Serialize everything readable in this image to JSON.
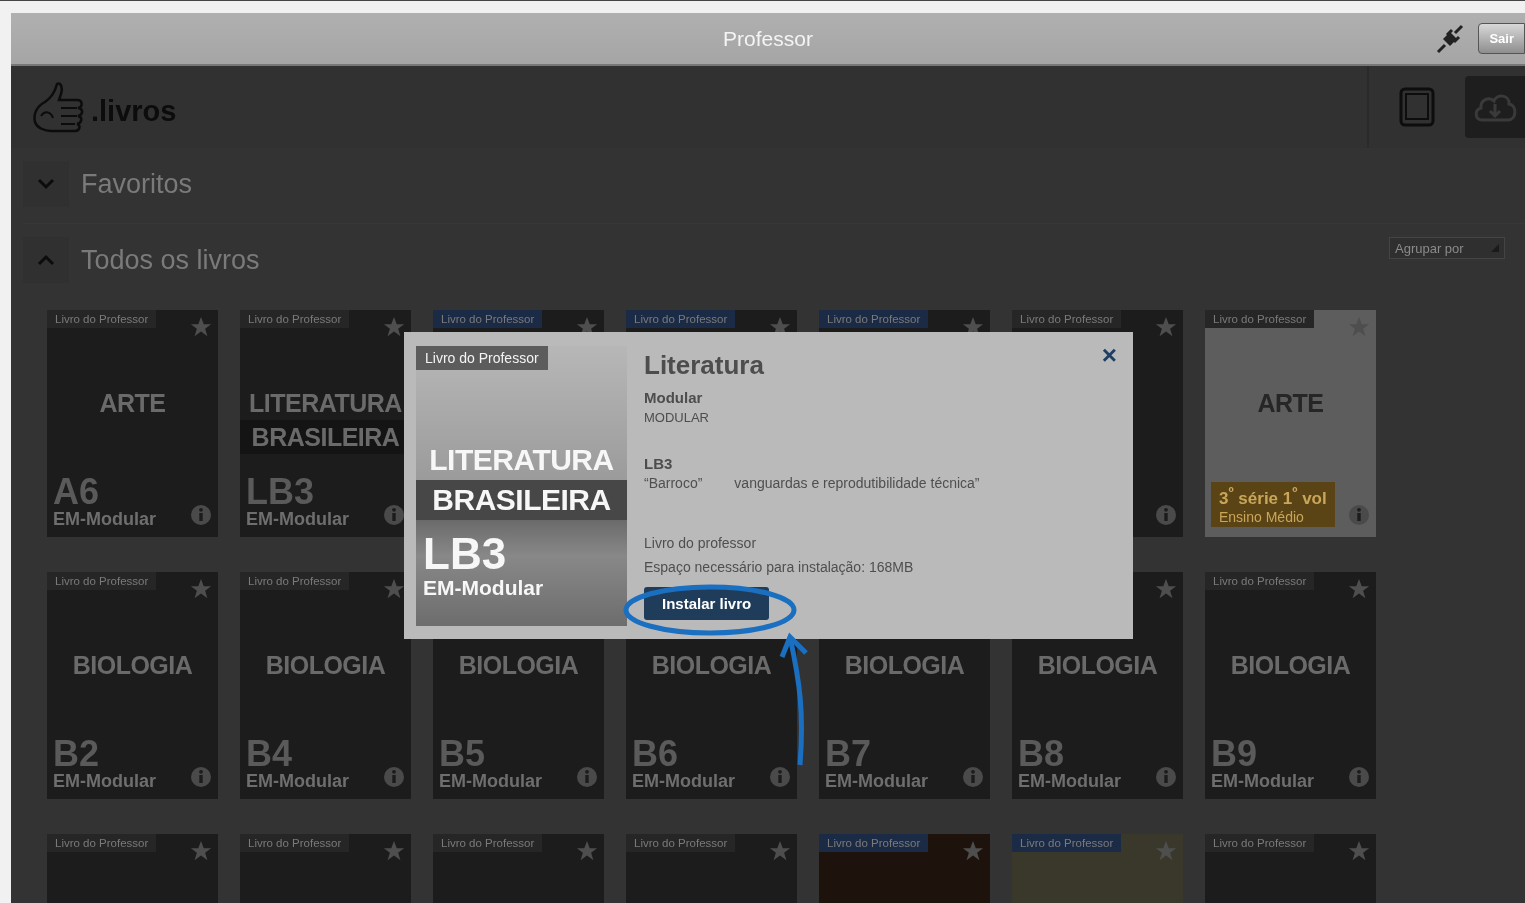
{
  "title_bar": {
    "title": "Professor",
    "logout_button": "Sair"
  },
  "header": {
    "logo_text": ".livros",
    "views": [
      {
        "kind": "tablet",
        "selected": false
      },
      {
        "kind": "cloud",
        "selected": true
      }
    ]
  },
  "sections": [
    {
      "title": "Favoritos",
      "expanded": false
    },
    {
      "title": "Todos os livros",
      "expanded": true,
      "group_select": "Agrupar por"
    }
  ],
  "books": [
    {
      "kind": "dark",
      "tag": {
        "label": "Livro do Professor",
        "color": "#262626"
      },
      "has_star": true,
      "has_info": true,
      "title_lines": [
        "ARTE"
      ],
      "code": "A6",
      "series": "EM-Modular"
    },
    {
      "kind": "banded",
      "tag": {
        "label": "Livro do Professor",
        "color": "#262626"
      },
      "has_star": true,
      "has_info": true,
      "title_lines": [
        "LITERATURA",
        "BRASILEIRA"
      ],
      "code": "LB3",
      "series": "EM-Modular"
    },
    {
      "kind": "dark",
      "tag": {
        "label": "Livro do Professor",
        "color": "#1b2b46"
      },
      "has_star": true,
      "has_info": false
    },
    {
      "kind": "dark",
      "tag": {
        "label": "Livro do Professor",
        "color": "#1b2b46"
      },
      "has_star": true,
      "has_info": false
    },
    {
      "kind": "dark",
      "tag": {
        "label": "Livro do Professor",
        "color": "#1b2b46"
      },
      "has_star": true,
      "has_info": false
    },
    {
      "kind": "dark",
      "tag": {
        "label": "Livro do Professor",
        "color": "#262626"
      },
      "has_star": true,
      "has_info": true
    },
    {
      "kind": "light",
      "tag": {
        "label": "Livro do Professor",
        "color": "#262626"
      },
      "has_star": true,
      "has_info": true,
      "title_lines": [
        "ARTE"
      ],
      "badge": [
        "3$^{º}$ série 1$^{º}$ vol",
        "Ensino Médio"
      ]
    },
    {
      "kind": "dark",
      "tag": {
        "label": "Livro do Professor",
        "color": "#262626"
      },
      "has_star": true,
      "has_info": true,
      "title_lines": [
        "BIOLOGIA"
      ],
      "code": "B2",
      "series": "EM-Modular"
    },
    {
      "kind": "dark",
      "tag": {
        "label": "Livro do Professor",
        "color": "#262626"
      },
      "has_star": true,
      "has_info": true,
      "title_lines": [
        "BIOLOGIA"
      ],
      "code": "B4",
      "series": "EM-Modular"
    },
    {
      "kind": "dark",
      "has_star": false,
      "has_info": true,
      "title_lines": [
        "BIOLOGIA"
      ],
      "code": "B5",
      "series": "EM-Modular"
    },
    {
      "kind": "dark",
      "has_star": false,
      "has_info": true,
      "title_lines": [
        "BIOLOGIA"
      ],
      "code": "B6",
      "series": "EM-Modular"
    },
    {
      "kind": "dark",
      "has_star": false,
      "has_info": true,
      "title_lines": [
        "BIOLOGIA"
      ],
      "code": "B7",
      "series": "EM-Modular"
    },
    {
      "kind": "dark",
      "has_star": true,
      "has_info": true,
      "title_lines": [
        "BIOLOGIA"
      ],
      "code": "B8",
      "series": "EM-Modular"
    },
    {
      "kind": "dark",
      "tag": {
        "label": "Livro do Professor",
        "color": "#262626"
      },
      "has_star": true,
      "has_info": true,
      "title_lines": [
        "BIOLOGIA"
      ],
      "code": "B9",
      "series": "EM-Modular"
    },
    {
      "kind": "dark",
      "tag": {
        "label": "Livro do Professor",
        "color": "#262626"
      },
      "has_star": true,
      "has_info": false
    },
    {
      "kind": "dark",
      "tag": {
        "label": "Livro do Professor",
        "color": "#262626"
      },
      "has_star": true,
      "has_info": false
    },
    {
      "kind": "dark",
      "tag": {
        "label": "Livro do Professor",
        "color": "#262626"
      },
      "has_star": true,
      "has_info": false
    },
    {
      "kind": "dark",
      "tag": {
        "label": "Livro do Professor",
        "color": "#262626"
      },
      "has_star": true,
      "has_info": false
    },
    {
      "kind": "brown",
      "tag": {
        "label": "Livro do Professor",
        "color": "#1b2b46"
      },
      "has_star": true,
      "has_info": false
    },
    {
      "kind": "olive",
      "tag": {
        "label": "Livro do Professor",
        "color": "#1b2b46"
      },
      "has_star": true,
      "has_info": false
    },
    {
      "kind": "dark",
      "tag": {
        "label": "Livro do Professor",
        "color": "#262626"
      },
      "has_star": true,
      "has_info": false
    }
  ],
  "dialog": {
    "cover": {
      "tag": "Livro do Professor",
      "title_lines": [
        "LITERATURA",
        "BRASILEIRA"
      ],
      "code": "LB3",
      "series": "EM-Modular"
    },
    "title": "Literatura",
    "subtitle": "Modular",
    "edition": "MODULAR",
    "code": "LB3",
    "description_start": "“Barroco”",
    "description_end": "vanguardas e reprodutibilidade técnica”",
    "type": "Livro do professor",
    "space": "Espaço necessário para instalação: 168MB",
    "install_button": "Instalar livro",
    "close": "×"
  }
}
